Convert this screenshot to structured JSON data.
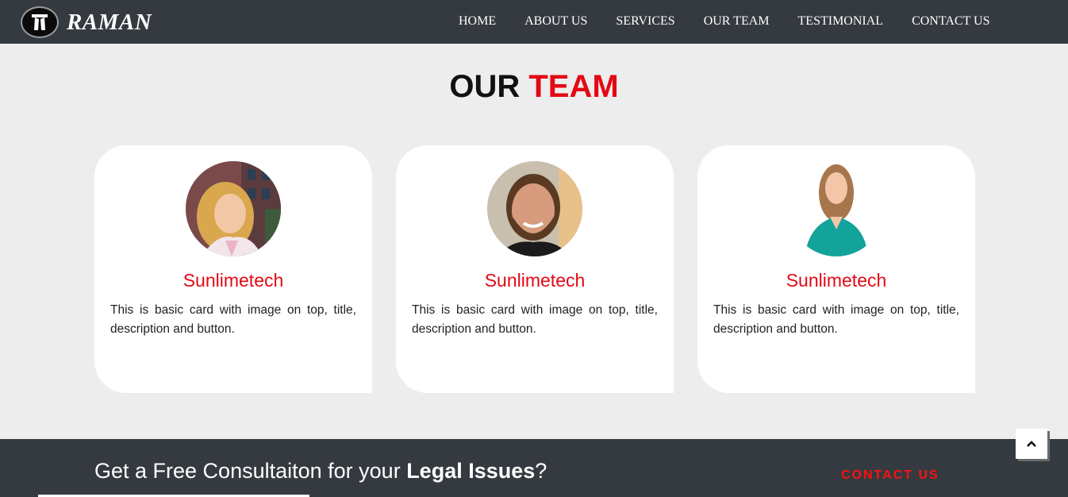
{
  "brand": {
    "name": "RAMAN",
    "logo_icon": "lawyer-bands-icon"
  },
  "nav": {
    "items": [
      "HOME",
      "ABOUT US",
      "SERVICES",
      "OUR TEAM",
      "TESTIMONIAL",
      "CONTACT US"
    ]
  },
  "section": {
    "title_main": "OUR",
    "title_accent": "TEAM"
  },
  "cards": [
    {
      "name": "Sunlimetech",
      "description": "This is basic card with image on top, title, description and button.",
      "photo": "woman-smiling-photo"
    },
    {
      "name": "Sunlimetech",
      "description": "This is basic card with image on top, title, description and button.",
      "photo": "bearded-man-photo"
    },
    {
      "name": "Sunlimetech",
      "description": "This is basic card with image on top, title, description and button.",
      "photo": "woman-teal-top-photo"
    }
  ],
  "footer": {
    "cta_plain": "Get a Free Consultaiton for your ",
    "cta_bold": "Legal Issues",
    "cta_end": "?",
    "contact_label": "CONTACT US"
  },
  "scroll_top_icon": "chevron-up-icon",
  "colors": {
    "accent": "#e30914",
    "navbar": "#343a40",
    "background": "#ededed"
  }
}
